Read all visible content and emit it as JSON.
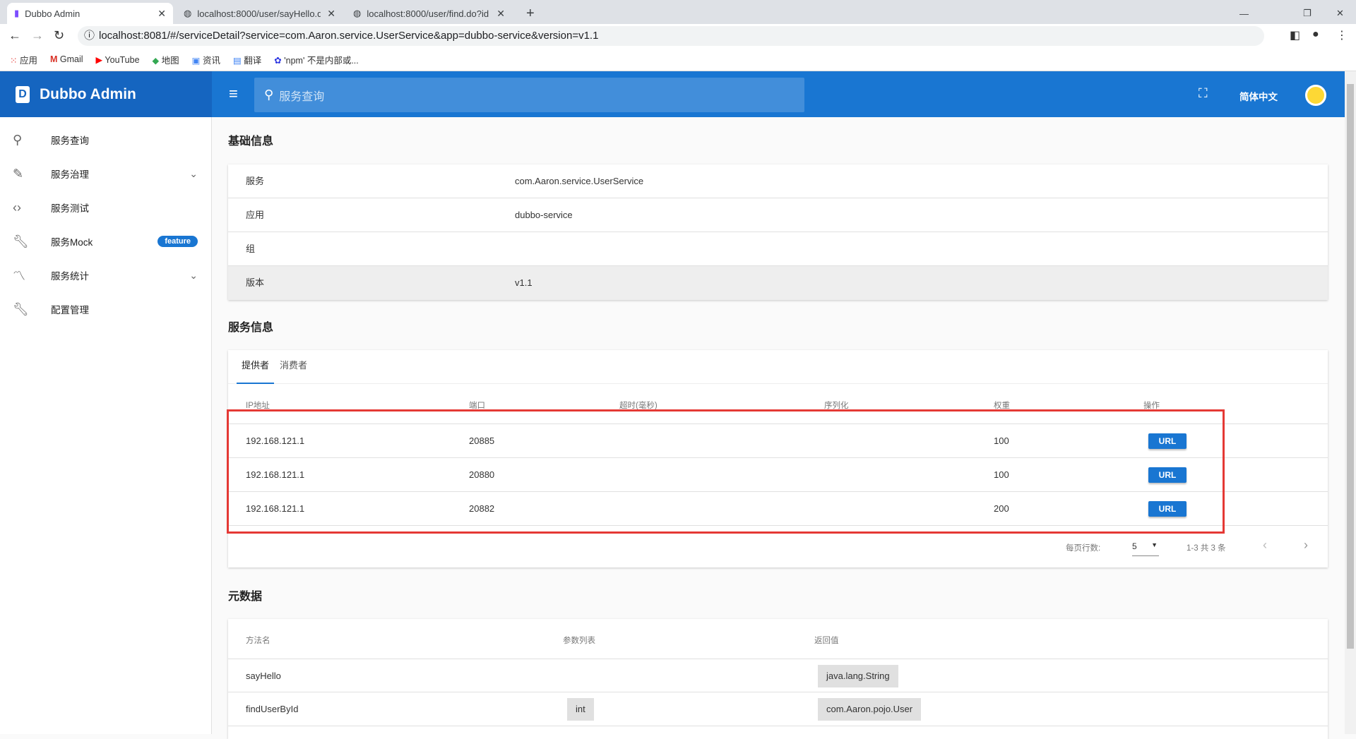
{
  "browser": {
    "tabs": [
      {
        "title": "Dubbo Admin"
      },
      {
        "title": "localhost:8000/user/sayHello.d"
      },
      {
        "title": "localhost:8000/user/find.do?id"
      }
    ],
    "url": "localhost:8081/#/serviceDetail?service=com.Aaron.service.UserService&app=dubbo-service&version=v1.1",
    "bookmarks": [
      "应用",
      "Gmail",
      "YouTube",
      "地图",
      "资讯",
      "翻译",
      "'npm' 不是内部或..."
    ]
  },
  "header": {
    "brand": "Dubbo Admin",
    "search_placeholder": "服务查询",
    "language": "简体中文"
  },
  "sidebar": {
    "items": [
      {
        "label": "服务查询",
        "icon": "search-icon"
      },
      {
        "label": "服务治理",
        "icon": "pencil-icon"
      },
      {
        "label": "服务测试",
        "icon": "code-icon"
      },
      {
        "label": "服务Mock",
        "icon": "wrench-icon",
        "badge": "feature"
      },
      {
        "label": "服务统计",
        "icon": "trending-icon"
      },
      {
        "label": "配置管理",
        "icon": "wrench-icon"
      }
    ]
  },
  "basic": {
    "title": "基础信息",
    "rows": [
      {
        "k": "服务",
        "v": "com.Aaron.service.UserService"
      },
      {
        "k": "应用",
        "v": "dubbo-service"
      },
      {
        "k": "组",
        "v": ""
      },
      {
        "k": "版本",
        "v": "v1.1"
      }
    ]
  },
  "service": {
    "title": "服务信息",
    "tabs": [
      "提供者",
      "消费者"
    ],
    "headers": [
      "IP地址",
      "端口",
      "超时(毫秒)",
      "序列化",
      "权重",
      "操作"
    ],
    "rows": [
      {
        "ip": "192.168.121.1",
        "port": "20885",
        "weight": "100",
        "op": "URL"
      },
      {
        "ip": "192.168.121.1",
        "port": "20880",
        "weight": "100",
        "op": "URL"
      },
      {
        "ip": "192.168.121.1",
        "port": "20882",
        "weight": "200",
        "op": "URL"
      }
    ],
    "rows_per_page_label": "每页行数:",
    "rows_per_page": "5",
    "range": "1-3 共 3 条"
  },
  "meta": {
    "title": "元数据",
    "headers": [
      "方法名",
      "参数列表",
      "返回值"
    ],
    "rows": [
      {
        "method": "sayHello",
        "params": "",
        "ret": "java.lang.String"
      },
      {
        "method": "findUserById",
        "params": "int",
        "ret": "com.Aaron.pojo.User"
      }
    ]
  },
  "colors": {
    "primary": "#1976d2",
    "highlight": "#e53935"
  }
}
